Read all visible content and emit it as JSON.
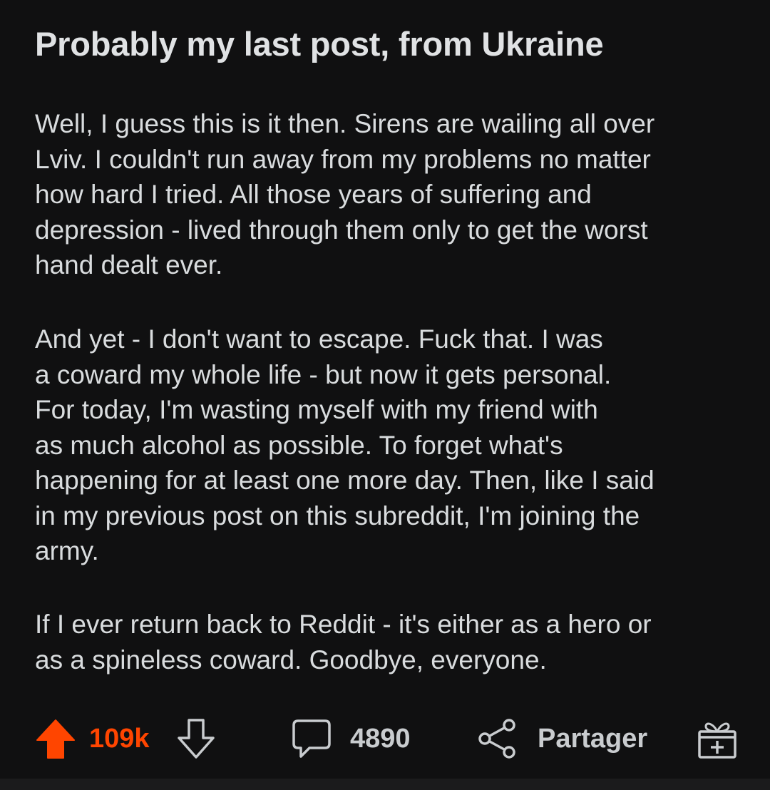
{
  "post": {
    "title": "Probably my last post, from Ukraine",
    "paragraphs": [
      {
        "lines": [
          "Well, I guess this is it then. Sirens are wailing all over",
          "Lviv. I couldn't run away from my problems no matter",
          "how hard I tried. All those years of suffering and",
          "depression - lived through them only to get the worst",
          "hand dealt ever."
        ]
      },
      {
        "lines": [
          "And yet - I don't want to escape. Fuck that. I was",
          "a coward my whole life - but now it gets personal.",
          "For today, I'm wasting myself with my friend with",
          "as much alcohol as possible. To forget what's",
          "happening for at least one more day. Then, like I said",
          "in my previous post on this subreddit, I'm joining the",
          "army."
        ]
      },
      {
        "lines": [
          "If I ever return back to Reddit - it's either as a hero or",
          "as a spineless coward. Goodbye, everyone."
        ]
      }
    ]
  },
  "actions": {
    "upvote_icon": "upvote-arrow-icon",
    "score": "109k",
    "downvote_icon": "downvote-arrow-icon",
    "comment_icon": "comment-bubble-icon",
    "comment_count": "4890",
    "share_icon": "share-icon",
    "share_label": "Partager",
    "award_icon": "gift-award-icon"
  },
  "colors": {
    "background": "#101011",
    "text": "#d9dcde",
    "upvote_active": "#ff4500",
    "icon": "#c9cccf"
  }
}
